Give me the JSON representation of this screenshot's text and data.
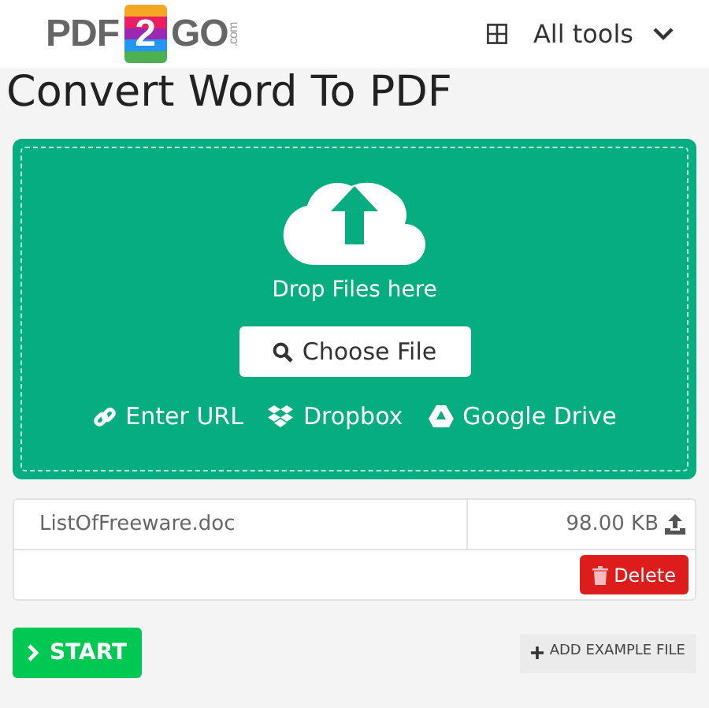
{
  "header": {
    "logo": {
      "left": "PDF",
      "middle": "2",
      "right": "GO",
      "suffix": ".com"
    },
    "menu": {
      "label": "All tools"
    }
  },
  "title": "Convert Word To PDF",
  "dropzone": {
    "hint": "Drop Files here",
    "choose_button": "Choose File",
    "sources": [
      {
        "kind": "url",
        "label": "Enter URL"
      },
      {
        "kind": "dropbox",
        "label": "Dropbox"
      },
      {
        "kind": "drive",
        "label": "Google Drive"
      }
    ]
  },
  "files": [
    {
      "name": "ListOfFreeware.doc",
      "size": "98.00 KB",
      "delete_button": "Delete"
    }
  ],
  "start_button": "START",
  "example_button": "ADD EXAMPLE FILE"
}
